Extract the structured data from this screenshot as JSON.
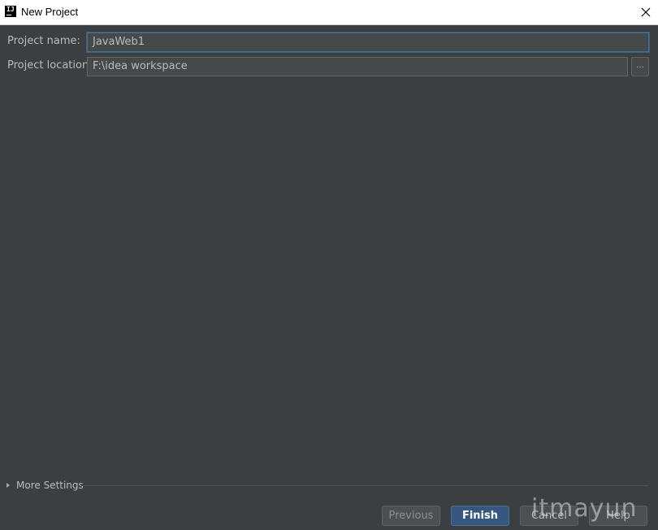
{
  "window": {
    "title": "New Project",
    "app_icon_text": "IJ",
    "close_icon": "close-icon"
  },
  "form": {
    "project_name_label": "Project name:",
    "project_name_value": "JavaWeb1",
    "project_location_label": "Project location:",
    "project_location_value": "F:\\idea workspace",
    "browse_label": "..."
  },
  "more_settings": {
    "label": "More Settings",
    "icon": "expand-triangle-icon",
    "expanded": false
  },
  "buttons": {
    "previous": "Previous",
    "finish": "Finish",
    "cancel": "Cancel",
    "help": "Help"
  },
  "watermark": "itmayun",
  "colors": {
    "background": "#3c3f41",
    "field_bg": "#45494a",
    "focus_border": "#466d94",
    "primary_button": "#365880",
    "text": "#bbbbbb"
  }
}
